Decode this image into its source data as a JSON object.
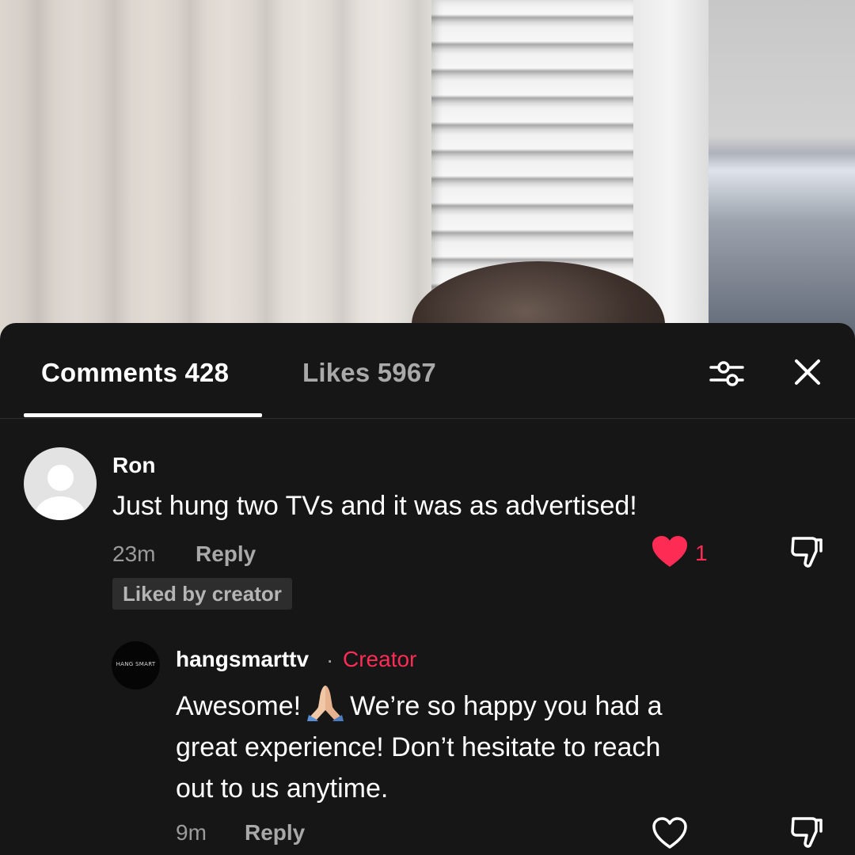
{
  "tabs": {
    "comments_label": "Comments 428",
    "likes_label": "Likes 5967"
  },
  "comments": [
    {
      "username": "Ron",
      "text": "Just hung two TVs and it was as advertised!",
      "time": "23m",
      "reply_label": "Reply",
      "like_count": "1",
      "badge": "Liked by creator",
      "liked": true
    }
  ],
  "reply": {
    "username": "hangsmarttv",
    "separator": "·",
    "role": "Creator",
    "avatar_text": "HANG SMART",
    "text_part1": "Awesome!",
    "emoji": "folded-hands",
    "text_part2": "We’re so happy you had a",
    "text_line2": "great experience! Don’t hesitate to reach",
    "text_line3": "out to us anytime.",
    "time": "9m",
    "reply_label": "Reply",
    "liked": false
  },
  "colors": {
    "accent": "#fe2c55",
    "sheet_bg": "#161616"
  },
  "icons": {
    "filter": "filter-sliders-icon",
    "close": "close-icon",
    "like": "heart-icon",
    "dislike": "thumbs-down-icon"
  }
}
